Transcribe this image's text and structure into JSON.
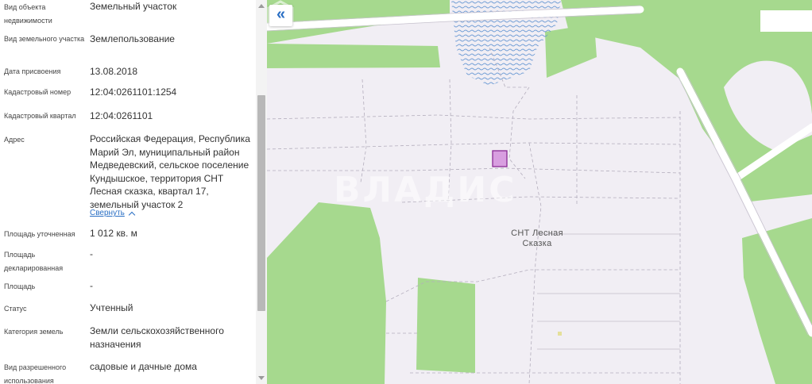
{
  "panel": {
    "fields": [
      {
        "label": "Вид объекта недвижимости",
        "value": "Земельный участок"
      },
      {
        "label": "Вид земельного участка",
        "value": "Землепользование"
      },
      {
        "label": "Дата присвоения",
        "value": "13.08.2018"
      },
      {
        "label": "Кадастровый номер",
        "value": "12:04:0261101:1254"
      },
      {
        "label": "Кадастровый квартал",
        "value": "12:04:0261101"
      },
      {
        "label": "Адрес",
        "value": "Российская Федерация, Республика Марий Эл, муниципальный район Медведевский, сельское поселение Кундышское, территория СНТ Лесная сказка, квартал 17, земельный участок 2"
      },
      {
        "label": "Площадь уточненная",
        "value": "1 012 кв. м"
      },
      {
        "label": "Площадь декларированная",
        "value": "-"
      },
      {
        "label": "Площадь",
        "value": "-"
      },
      {
        "label": "Статус",
        "value": "Учтенный"
      },
      {
        "label": "Категория земель",
        "value": "Земли сельскохозяйственного назначения"
      },
      {
        "label": "Вид разрешенного использования",
        "value": "садовые и дачные дома"
      }
    ],
    "collapse_link": "Свернуть"
  },
  "map": {
    "collapse_button_icon": "«",
    "area_label": "СНТ Лесная Сказка",
    "watermark_text": "ВЛАДИС",
    "colors": {
      "background": "#f1eef4",
      "forest": "#a6d98e",
      "water_pattern": "#5a8fd0",
      "parcel": "#d89ee0",
      "road": "#ffffff"
    }
  }
}
